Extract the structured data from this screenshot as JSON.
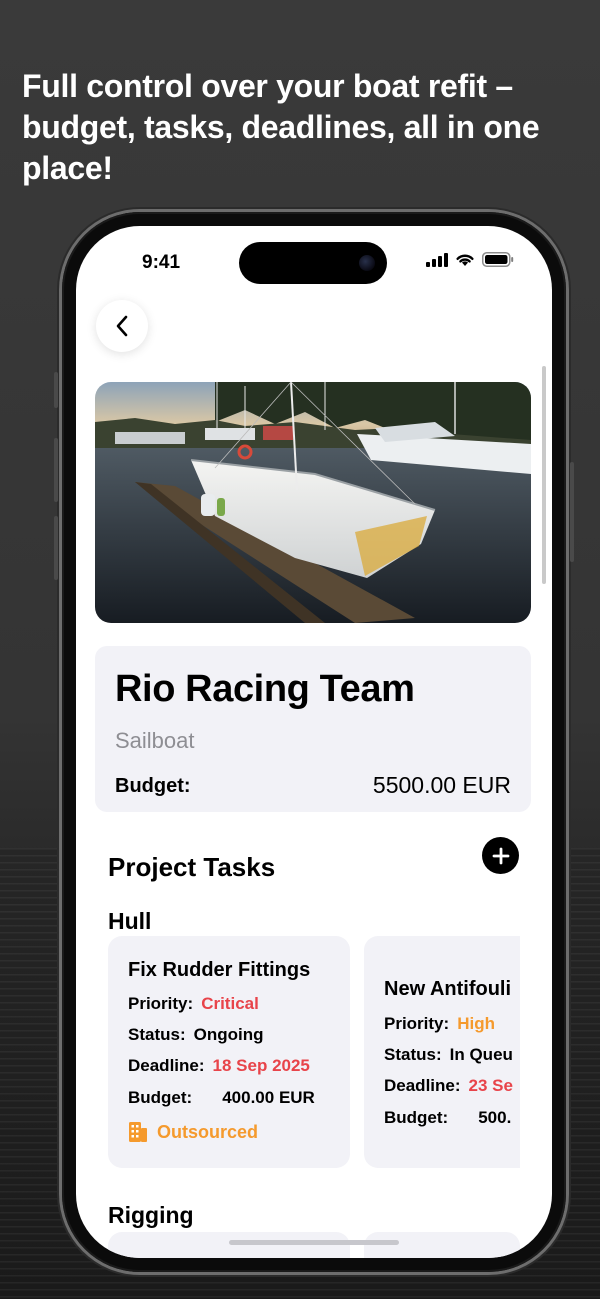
{
  "headline": "Full control over your boat refit – budget, tasks, deadlines, all in one place!",
  "status_bar": {
    "time": "9:41"
  },
  "project": {
    "name": "Rio Racing Team",
    "type": "Sailboat",
    "budget_label": "Budget:",
    "budget_value": "5500.00 EUR"
  },
  "tasks_section": {
    "title": "Project Tasks"
  },
  "groups": {
    "hull": {
      "title": "Hull"
    },
    "rigging": {
      "title": "Rigging"
    }
  },
  "tasks": [
    {
      "title": "Fix Rudder Fittings",
      "priority_label": "Priority:",
      "priority": "Critical",
      "status_label": "Status:",
      "status": "Ongoing",
      "deadline_label": "Deadline:",
      "deadline": "18 Sep 2025",
      "budget_label": "Budget:",
      "budget": "400.00 EUR",
      "outsourced": "Outsourced"
    },
    {
      "title": "New Antifouli",
      "priority_label": "Priority:",
      "priority": "High",
      "status_label": "Status:",
      "status": "In Queu",
      "deadline_label": "Deadline:",
      "deadline": "23 Se",
      "budget_label": "Budget:",
      "budget": "500."
    }
  ],
  "colors": {
    "critical": "#e8444a",
    "high": "#f59a2d",
    "deadline": "#e8444a",
    "card_background": "#f2f2f7"
  },
  "icons": [
    "chevron-left-icon",
    "plus-icon",
    "building-icon",
    "signal-icon",
    "wifi-icon",
    "battery-icon"
  ]
}
